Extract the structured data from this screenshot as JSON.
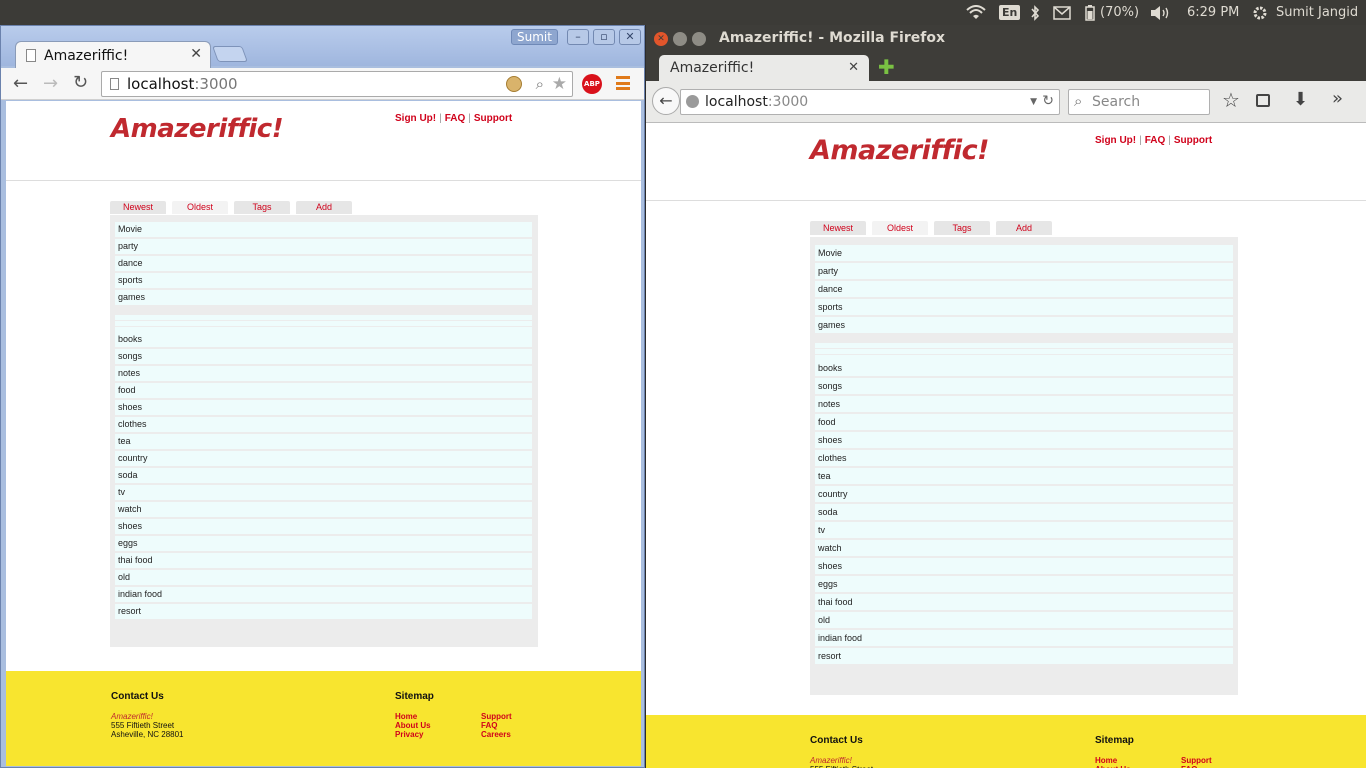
{
  "panel": {
    "keyboard": "En",
    "battery": "(70%)",
    "time": "6:29 PM",
    "user": "Sumit Jangid"
  },
  "chrome": {
    "tab_title": "Amazeriffic!",
    "profile_name": "Sumit",
    "url_host": "localhost",
    "url_port": ":3000",
    "abp_label": "ABP"
  },
  "firefox": {
    "window_title": "Amazeriffic! - Mozilla Firefox",
    "tab_title": "Amazeriffic!",
    "url_host": "localhost",
    "url_port": ":3000",
    "search_placeholder": "Search"
  },
  "page": {
    "logo": "Amazeriffic!",
    "top_links": [
      "Sign Up!",
      "FAQ",
      "Support"
    ],
    "separator": "|",
    "tabs": [
      {
        "label": "Newest",
        "active": false
      },
      {
        "label": "Oldest",
        "active": true
      },
      {
        "label": "Tags",
        "active": false
      },
      {
        "label": "Add",
        "active": false
      }
    ],
    "items": [
      "Movie",
      "party",
      "dance",
      "sports",
      "games",
      "",
      "",
      "",
      "books",
      "songs",
      "notes",
      "food",
      "shoes",
      "clothes",
      "tea",
      "country",
      "soda",
      "tv",
      "watch",
      "shoes",
      "eggs",
      "thai food",
      "old",
      "indian food",
      "resort"
    ],
    "footer": {
      "contact_heading": "Contact Us",
      "company": "Amazeriffic!",
      "street": "555 Fiftieth Street",
      "city": "Asheville, NC 28801",
      "sitemap_heading": "Sitemap",
      "sitemap_col1": [
        "Home",
        "About Us",
        "Privacy"
      ],
      "sitemap_col2": [
        "Support",
        "FAQ",
        "Careers"
      ]
    }
  },
  "colors": {
    "brand": "#c0292f",
    "link": "#d0021b",
    "footer_bg": "#f8e52f",
    "item_bg": "#eefcfc",
    "list_bg": "#ececec"
  }
}
